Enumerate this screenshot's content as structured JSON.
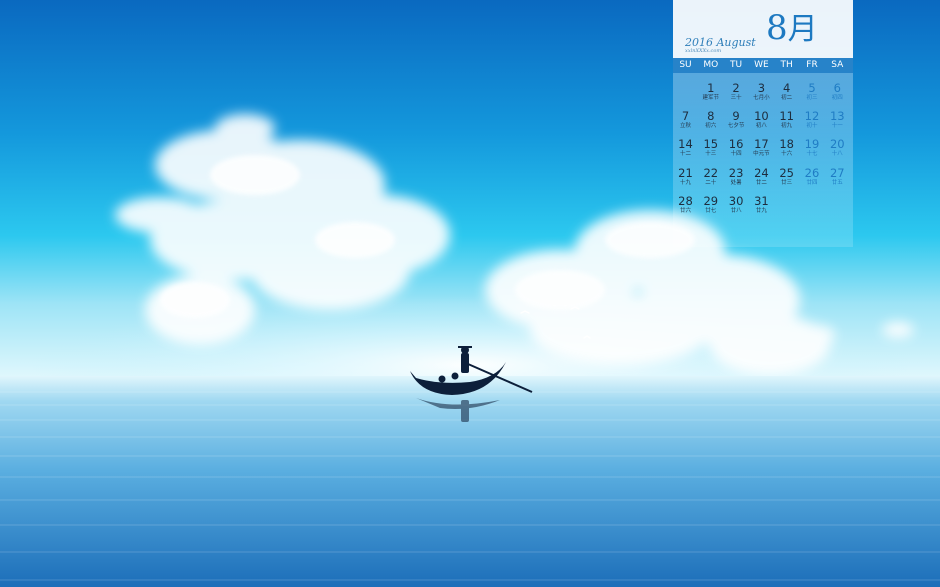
{
  "calendar": {
    "year_line": "2016 August",
    "watermark": "xxlnXXXx.com",
    "month_number": "8",
    "month_char": "月",
    "weekdays": [
      "SU",
      "MO",
      "TU",
      "WE",
      "TH",
      "FR",
      "SA"
    ],
    "first_weekday_index": 1,
    "days": [
      {
        "n": "1",
        "l": "建军节"
      },
      {
        "n": "2",
        "l": "三十"
      },
      {
        "n": "3",
        "l": "七月小"
      },
      {
        "n": "4",
        "l": "初二"
      },
      {
        "n": "5",
        "l": "初三"
      },
      {
        "n": "6",
        "l": "初四"
      },
      {
        "n": "7",
        "l": "立秋"
      },
      {
        "n": "8",
        "l": "初六"
      },
      {
        "n": "9",
        "l": "七夕节"
      },
      {
        "n": "10",
        "l": "初八"
      },
      {
        "n": "11",
        "l": "初九"
      },
      {
        "n": "12",
        "l": "初十"
      },
      {
        "n": "13",
        "l": "十一"
      },
      {
        "n": "14",
        "l": "十二"
      },
      {
        "n": "15",
        "l": "十三"
      },
      {
        "n": "16",
        "l": "十四"
      },
      {
        "n": "17",
        "l": "中元节"
      },
      {
        "n": "18",
        "l": "十六"
      },
      {
        "n": "19",
        "l": "十七"
      },
      {
        "n": "20",
        "l": "十八"
      },
      {
        "n": "21",
        "l": "十九"
      },
      {
        "n": "22",
        "l": "二十"
      },
      {
        "n": "23",
        "l": "处暑"
      },
      {
        "n": "24",
        "l": "廿二"
      },
      {
        "n": "25",
        "l": "廿三"
      },
      {
        "n": "26",
        "l": "廿四"
      },
      {
        "n": "27",
        "l": "廿五"
      },
      {
        "n": "28",
        "l": "廿六"
      },
      {
        "n": "29",
        "l": "廿七"
      },
      {
        "n": "30",
        "l": "廿八"
      },
      {
        "n": "31",
        "l": "廿九"
      }
    ]
  },
  "colors": {
    "sky_top": "#0b72c6",
    "sky_mid": "#27c4ee",
    "horizon": "#d6f6fd",
    "sea": "#5aaee0",
    "sea_deep": "#1c6eb9",
    "weekday_bar": "#2783c9",
    "weekend_text": "#1f7cc4",
    "day_text": "#1d2d3f"
  }
}
